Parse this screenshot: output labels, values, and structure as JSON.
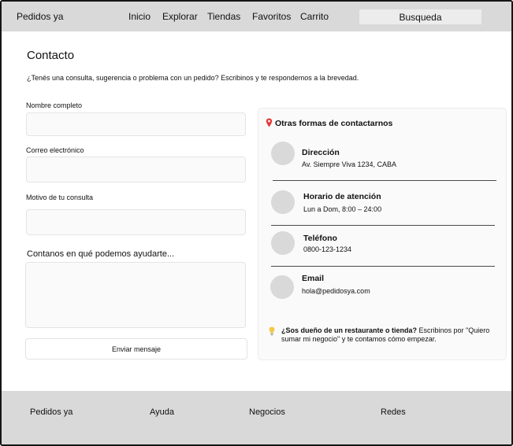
{
  "header": {
    "brand": "Pedidos ya",
    "nav": [
      "Inicio",
      "Explorar",
      "Tiendas",
      "Favoritos",
      "Carrito"
    ],
    "search_label": "Busqueda"
  },
  "page": {
    "title": "Contacto",
    "subtitle": "¿Tenés una consulta, sugerencia o problema con un pedido? Escribinos y te respondemos a la brevedad."
  },
  "form": {
    "name_label": "Nombre completo",
    "email_label": "Correo electrónico",
    "reason_label": "Motivo de tu consulta",
    "message_prompt": "Contanos en qué podemos ayudarte...",
    "submit_label": "Enviar mensaje"
  },
  "contact": {
    "title": "Otras formas de contactarnos",
    "items": [
      {
        "title": "Dirección",
        "value": "Av. Siempre Viva 1234, CABA"
      },
      {
        "title": "Horario de atención",
        "value": "Lun a Dom, 8:00 – 24:00"
      },
      {
        "title": "Teléfono",
        "value": "0800-123-1234"
      },
      {
        "title": "Email",
        "value": "hola@pedidosya.com"
      }
    ],
    "tip_bold": "¿Sos dueño de un restaurante o tienda?",
    "tip_text": " Escribinos por  \"Quiero sumar mi negocio\" y te contamos cómo empezar.",
    "icons": {
      "pin": "map-pin-icon",
      "bulb": "lightbulb-icon"
    },
    "pin_color": "#e53935",
    "bulb_color": "#f2c94c"
  },
  "footer": {
    "items": [
      "Pedidos ya",
      "Ayuda",
      "Negocios",
      "Redes"
    ]
  }
}
